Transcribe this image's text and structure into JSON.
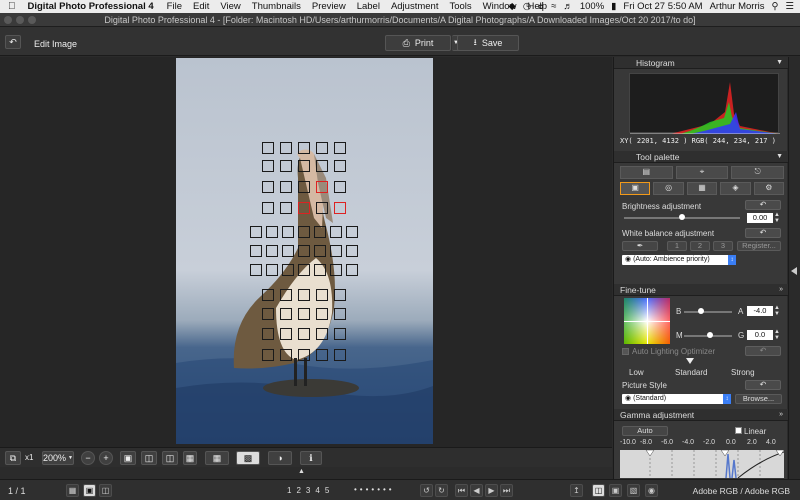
{
  "menubar": {
    "app_name": "Digital Photo Professional 4",
    "items": [
      "File",
      "Edit",
      "View",
      "Thumbnails",
      "Preview",
      "Label",
      "Adjustment",
      "Tools",
      "Window",
      "Help"
    ],
    "battery": "100%",
    "clock": "Fri Oct 27  5:50 AM",
    "user": "Arthur Morris"
  },
  "window": {
    "title": "Digital Photo Professional 4 - [Folder: Macintosh HD/Users/arthurmorris/Documents/A Digital Photographs/A Downloaded Images/Oct 20 2017/to do]"
  },
  "toolbar": {
    "edit_image_label": "Edit Image",
    "print_label": "Print",
    "save_label": "Save"
  },
  "statusbar": {
    "zoom_x": "x1",
    "zoom_level": "200%"
  },
  "bottombar": {
    "page_count": "1 / 1",
    "ratings": [
      "1",
      "2",
      "3",
      "4",
      "5"
    ],
    "color_profile": "Adobe RGB / Adobe RGB"
  },
  "histogram": {
    "title": "Histogram",
    "readout": "XY(  2201,   4132 ) RGB( 244, 234, 217 )"
  },
  "tool_palette": {
    "title": "Tool palette",
    "brightness_label": "Brightness adjustment",
    "brightness_value": "0.00",
    "brightness_level": 0.5,
    "white_balance_label": "White balance adjustment",
    "wb_presets": [
      "1",
      "2",
      "3"
    ],
    "register_label": "Register...",
    "wb_mode": "(Auto: Ambience priority)"
  },
  "fine_tune": {
    "title": "Fine-tune",
    "b_label": "B",
    "a_label": "A",
    "a_value": "-4.0",
    "m_label": "M",
    "g_label": "G",
    "g_value": "0.0",
    "alo_label": "Auto Lighting Optimizer",
    "alo_levels": [
      "Low",
      "Standard",
      "Strong"
    ],
    "picture_style_label": "Picture Style",
    "picture_style_value": "(Standard)",
    "browse_label": "Browse..."
  },
  "gamma": {
    "title": "Gamma adjustment",
    "auto_label": "Auto",
    "linear_label": "Linear",
    "scale": [
      "-10.0",
      "-8.0",
      "-6.0",
      "-4.0",
      "-2.0",
      "0.0",
      "2.0",
      "4.0"
    ]
  },
  "colors": {
    "accent_blue": "#3a7ef5",
    "af_point_active": "#dd2222"
  }
}
